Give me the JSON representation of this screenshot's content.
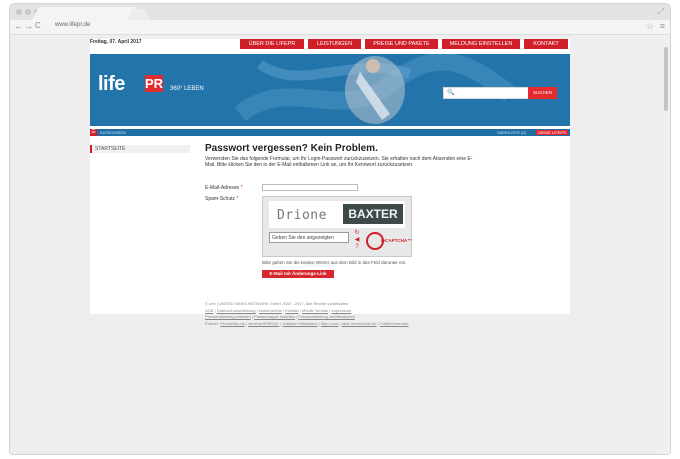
{
  "browser": {
    "url": "www.lifepr.de",
    "back_icon": "←",
    "forward_icon": "→",
    "reload_icon": "C",
    "bookmark_icon": "☆",
    "menu_icon": "≡"
  },
  "header": {
    "date": "Freitag, 07. April 2017",
    "nav": [
      "ÜBER DIE LIFEPR",
      "LEISTUNGEN",
      "PREISE UND PAKETE",
      "MELDUNG EINSTELLEN",
      "KONTAKT"
    ]
  },
  "banner": {
    "logo_text": "life",
    "logo_badge": "PR",
    "tagline": "360° LEBEN",
    "search_icon": "🔍",
    "search_button": "SUCHEN"
  },
  "subbar": {
    "categories": "KATEGORIEN",
    "merkliste": "MERKLISTE (0)",
    "meine": "MEINE LIFEPR"
  },
  "sidebar": {
    "start": "STARTSEITE"
  },
  "main": {
    "title": "Passwort vergessen? Kein Problem.",
    "intro": "Verwenden Sie das folgende Formular, um Ihr Login-Passwort zurückzusetzen. Sie erhalten nach dem Absenden eine E-Mail. Bitte klicken Sie den in der E-Mail enthaltenen Link an, um Ihr Kennwort zurückzusetzen.",
    "email_label": "E-Mail-Adresse",
    "spam_label": "Spam-Schutz",
    "required_mark": "*",
    "captcha_word1": "Drione",
    "captcha_word2": "BAXTER",
    "captcha_placeholder": "Geben Sie den angezeigten",
    "captcha_brand": "reCAPTCHA™",
    "captcha_hint": "Bitte geben Sie die beiden Wörter aus dem Bild in das Feld darunter ein.",
    "submit": "E-Mail mit Änderungs-Link anfordern"
  },
  "footer": {
    "copyright": "© unn | UNITED NEWS NETWORK GmbH 2002 - 2017, Alle Rechte vorbehalten",
    "links1": [
      "AGB",
      "Datenschutzerklärung",
      "Nutzerrechte",
      "Kontakt",
      "Mobile Version",
      "Impressum"
    ],
    "links2": [
      "Pressemitteilung erstellen",
      "Pressemappe erstellen",
      "Pressemitteilung veröffentlichen"
    ],
    "partner_label": "Partner:",
    "partners": [
      "Pressefibo.de",
      "seminarSPIEGEL",
      "Initiative Mittelstand",
      "lifpro.com",
      "aktiv verzeichnis.de",
      "TrafficGenerator"
    ]
  },
  "colors": {
    "brand_red": "#cf1f28",
    "banner_blue": "#1e6fa6"
  }
}
